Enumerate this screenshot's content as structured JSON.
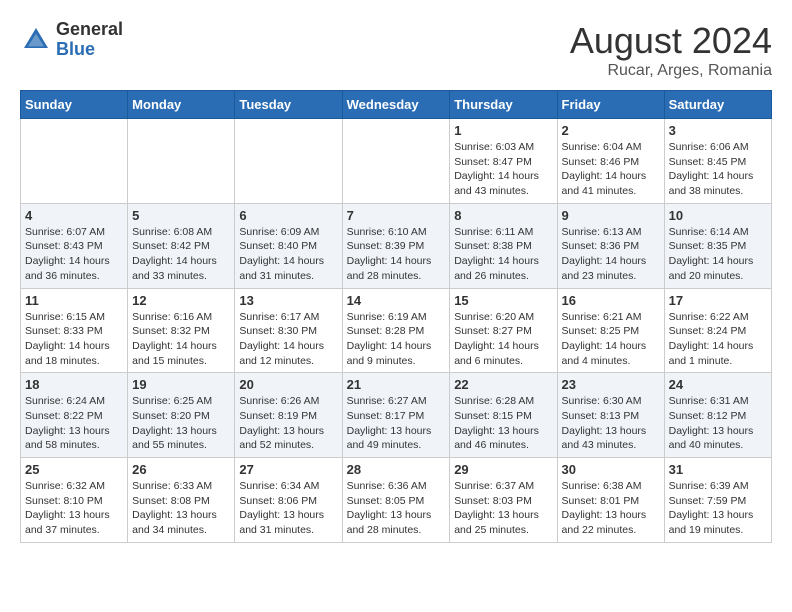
{
  "header": {
    "logo": {
      "general": "General",
      "blue": "Blue"
    },
    "title": "August 2024",
    "subtitle": "Rucar, Arges, Romania"
  },
  "weekdays": [
    "Sunday",
    "Monday",
    "Tuesday",
    "Wednesday",
    "Thursday",
    "Friday",
    "Saturday"
  ],
  "weeks": [
    [
      {
        "day": "",
        "info": ""
      },
      {
        "day": "",
        "info": ""
      },
      {
        "day": "",
        "info": ""
      },
      {
        "day": "",
        "info": ""
      },
      {
        "day": "1",
        "info": "Sunrise: 6:03 AM\nSunset: 8:47 PM\nDaylight: 14 hours\nand 43 minutes."
      },
      {
        "day": "2",
        "info": "Sunrise: 6:04 AM\nSunset: 8:46 PM\nDaylight: 14 hours\nand 41 minutes."
      },
      {
        "day": "3",
        "info": "Sunrise: 6:06 AM\nSunset: 8:45 PM\nDaylight: 14 hours\nand 38 minutes."
      }
    ],
    [
      {
        "day": "4",
        "info": "Sunrise: 6:07 AM\nSunset: 8:43 PM\nDaylight: 14 hours\nand 36 minutes."
      },
      {
        "day": "5",
        "info": "Sunrise: 6:08 AM\nSunset: 8:42 PM\nDaylight: 14 hours\nand 33 minutes."
      },
      {
        "day": "6",
        "info": "Sunrise: 6:09 AM\nSunset: 8:40 PM\nDaylight: 14 hours\nand 31 minutes."
      },
      {
        "day": "7",
        "info": "Sunrise: 6:10 AM\nSunset: 8:39 PM\nDaylight: 14 hours\nand 28 minutes."
      },
      {
        "day": "8",
        "info": "Sunrise: 6:11 AM\nSunset: 8:38 PM\nDaylight: 14 hours\nand 26 minutes."
      },
      {
        "day": "9",
        "info": "Sunrise: 6:13 AM\nSunset: 8:36 PM\nDaylight: 14 hours\nand 23 minutes."
      },
      {
        "day": "10",
        "info": "Sunrise: 6:14 AM\nSunset: 8:35 PM\nDaylight: 14 hours\nand 20 minutes."
      }
    ],
    [
      {
        "day": "11",
        "info": "Sunrise: 6:15 AM\nSunset: 8:33 PM\nDaylight: 14 hours\nand 18 minutes."
      },
      {
        "day": "12",
        "info": "Sunrise: 6:16 AM\nSunset: 8:32 PM\nDaylight: 14 hours\nand 15 minutes."
      },
      {
        "day": "13",
        "info": "Sunrise: 6:17 AM\nSunset: 8:30 PM\nDaylight: 14 hours\nand 12 minutes."
      },
      {
        "day": "14",
        "info": "Sunrise: 6:19 AM\nSunset: 8:28 PM\nDaylight: 14 hours\nand 9 minutes."
      },
      {
        "day": "15",
        "info": "Sunrise: 6:20 AM\nSunset: 8:27 PM\nDaylight: 14 hours\nand 6 minutes."
      },
      {
        "day": "16",
        "info": "Sunrise: 6:21 AM\nSunset: 8:25 PM\nDaylight: 14 hours\nand 4 minutes."
      },
      {
        "day": "17",
        "info": "Sunrise: 6:22 AM\nSunset: 8:24 PM\nDaylight: 14 hours\nand 1 minute."
      }
    ],
    [
      {
        "day": "18",
        "info": "Sunrise: 6:24 AM\nSunset: 8:22 PM\nDaylight: 13 hours\nand 58 minutes."
      },
      {
        "day": "19",
        "info": "Sunrise: 6:25 AM\nSunset: 8:20 PM\nDaylight: 13 hours\nand 55 minutes."
      },
      {
        "day": "20",
        "info": "Sunrise: 6:26 AM\nSunset: 8:19 PM\nDaylight: 13 hours\nand 52 minutes."
      },
      {
        "day": "21",
        "info": "Sunrise: 6:27 AM\nSunset: 8:17 PM\nDaylight: 13 hours\nand 49 minutes."
      },
      {
        "day": "22",
        "info": "Sunrise: 6:28 AM\nSunset: 8:15 PM\nDaylight: 13 hours\nand 46 minutes."
      },
      {
        "day": "23",
        "info": "Sunrise: 6:30 AM\nSunset: 8:13 PM\nDaylight: 13 hours\nand 43 minutes."
      },
      {
        "day": "24",
        "info": "Sunrise: 6:31 AM\nSunset: 8:12 PM\nDaylight: 13 hours\nand 40 minutes."
      }
    ],
    [
      {
        "day": "25",
        "info": "Sunrise: 6:32 AM\nSunset: 8:10 PM\nDaylight: 13 hours\nand 37 minutes."
      },
      {
        "day": "26",
        "info": "Sunrise: 6:33 AM\nSunset: 8:08 PM\nDaylight: 13 hours\nand 34 minutes."
      },
      {
        "day": "27",
        "info": "Sunrise: 6:34 AM\nSunset: 8:06 PM\nDaylight: 13 hours\nand 31 minutes."
      },
      {
        "day": "28",
        "info": "Sunrise: 6:36 AM\nSunset: 8:05 PM\nDaylight: 13 hours\nand 28 minutes."
      },
      {
        "day": "29",
        "info": "Sunrise: 6:37 AM\nSunset: 8:03 PM\nDaylight: 13 hours\nand 25 minutes."
      },
      {
        "day": "30",
        "info": "Sunrise: 6:38 AM\nSunset: 8:01 PM\nDaylight: 13 hours\nand 22 minutes."
      },
      {
        "day": "31",
        "info": "Sunrise: 6:39 AM\nSunset: 7:59 PM\nDaylight: 13 hours\nand 19 minutes."
      }
    ]
  ]
}
